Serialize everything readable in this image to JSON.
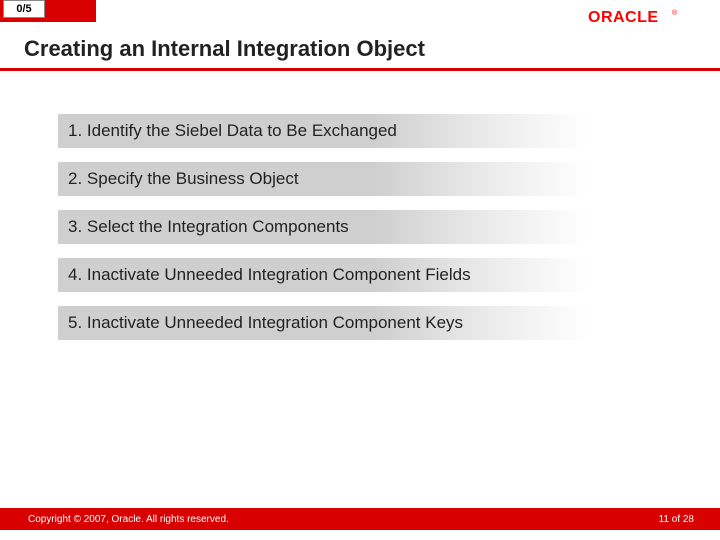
{
  "progress": "0/5",
  "title": "Creating an Internal Integration Object",
  "steps": [
    "1. Identify the Siebel Data to Be Exchanged",
    "2. Specify the Business Object",
    "3. Select the Integration Components",
    "4. Inactivate Unneeded Integration Component Fields",
    "5. Inactivate Unneeded Integration Component Keys"
  ],
  "copyright": "Copyright © 2007, Oracle. All rights reserved.",
  "page": "11 of 28",
  "logo_text": "ORACLE",
  "logo_color": "#ff0000"
}
